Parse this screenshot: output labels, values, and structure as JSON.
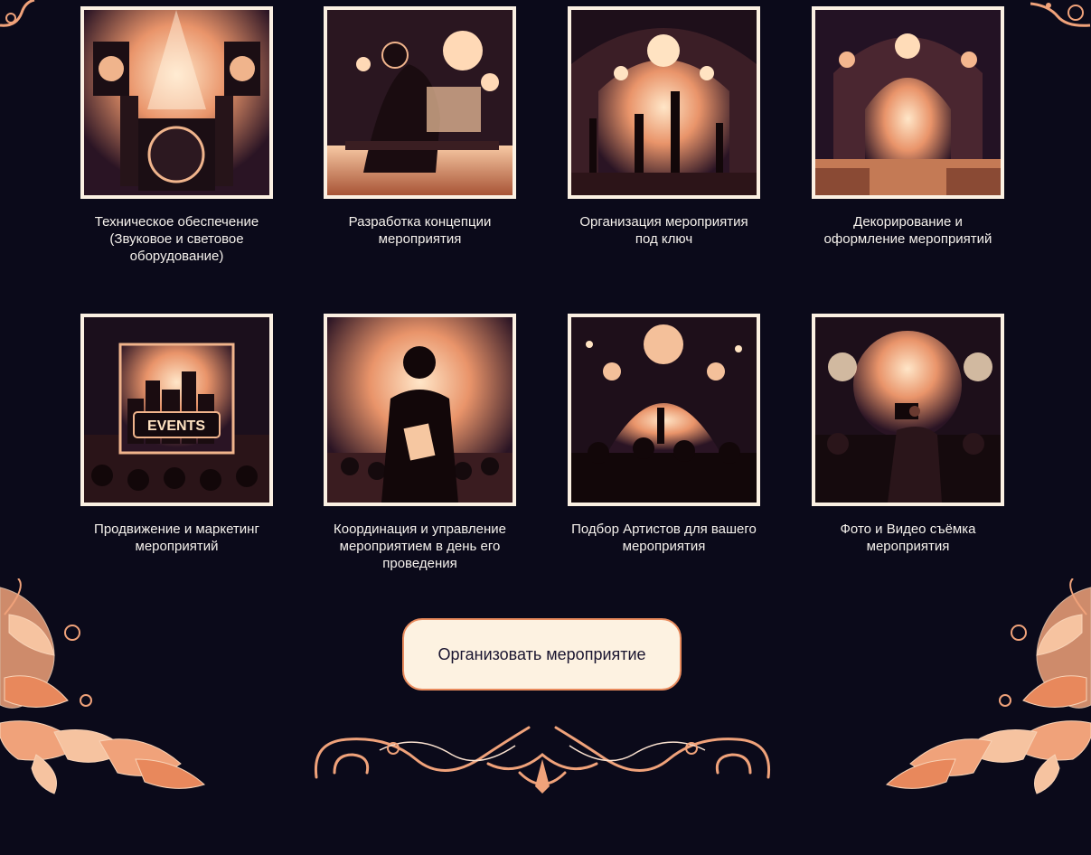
{
  "colors": {
    "background": "#0b0a1a",
    "accent": "#e98b5d",
    "frame": "#fbf0e2",
    "button_bg": "#fdf2e1"
  },
  "services": [
    {
      "caption": "Техническое обеспечение (Звуковое и световое оборудование)",
      "icon": "sound-equipment-illustration"
    },
    {
      "caption": "Разработка концепции мероприятия",
      "icon": "concept-design-illustration"
    },
    {
      "caption": "Организация мероприятия под ключ",
      "icon": "turnkey-event-illustration"
    },
    {
      "caption": "Декорирование и оформление мероприятий",
      "icon": "decoration-illustration"
    },
    {
      "caption": "Продвижение и маркетинг мероприятий",
      "icon": "marketing-illustration",
      "image_text": "EVENTS"
    },
    {
      "caption": "Координация и управление мероприятием в день его проведения",
      "icon": "coordination-illustration"
    },
    {
      "caption": "Подбор Артистов для вашего мероприятия",
      "icon": "artists-illustration"
    },
    {
      "caption": "Фото и Видео съёмка мероприятия",
      "icon": "photo-video-illustration"
    }
  ],
  "cta": {
    "label": "Организовать мероприятие"
  }
}
